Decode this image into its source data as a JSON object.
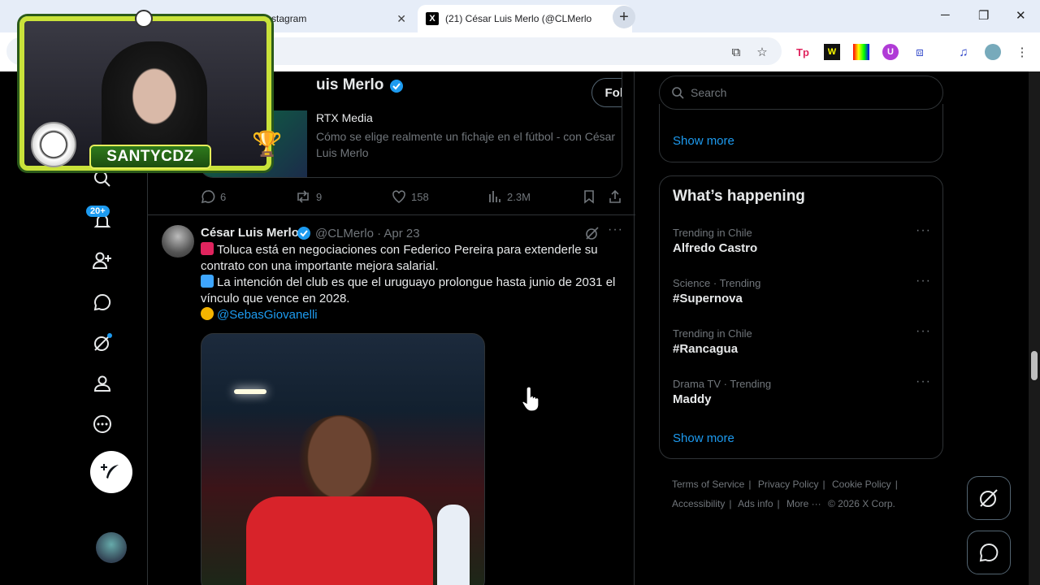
{
  "browser": {
    "tabs": [
      {
        "title": "Instagram"
      },
      {
        "title": "(21) César Luis Merlo (@CLMerlo"
      }
    ],
    "new_tab": "+"
  },
  "profile_header": {
    "name": "uis Merlo",
    "follow_button": "Following"
  },
  "link_card": {
    "source": "RTX Media",
    "title": "Cómo se elige realmente un fichaje en el fútbol - con César Luis Merlo"
  },
  "prev_tweet_actions": {
    "replies": "6",
    "reposts": "9",
    "likes": "158",
    "views": "2.3M"
  },
  "tweet": {
    "name": "César Luis Merlo",
    "handle": "@CLMerlo · Apr 23",
    "line1": "Toluca está en negociaciones con Federico Pereira para extenderle su",
    "line2": "contrato con una importante mejora salarial.",
    "line3": "La intención del club es que el uruguayo prolongue hasta junio de 2031 el",
    "line4": "vínculo que vence en 2028.",
    "mention": "@SebasGiovanelli"
  },
  "sidebar": {
    "notifications_badge": "20+"
  },
  "right": {
    "search_placeholder": "Search",
    "show_more": "Show more",
    "whats_happening": "What’s happening",
    "trends": [
      {
        "context": "Trending in Chile",
        "title": "Alfredo Castro"
      },
      {
        "context": "Science · Trending",
        "title": "#Supernova"
      },
      {
        "context": "Trending in Chile",
        "title": "#Rancagua"
      },
      {
        "context": "Drama TV · Trending",
        "title": "Maddy"
      }
    ],
    "show_more_2": "Show more",
    "footer": {
      "terms": "Terms of Service",
      "privacy": "Privacy Policy",
      "cookie": "Cookie Policy",
      "accessibility": "Accessibility",
      "ads": "Ads info",
      "more": "More ···",
      "copyright": "© 2026 X Corp."
    }
  },
  "overlay": {
    "streamer_name": "SANTYCDZ"
  },
  "colors": {
    "accent": "#1d9bf0",
    "background": "#000000",
    "muted": "#71767b"
  }
}
